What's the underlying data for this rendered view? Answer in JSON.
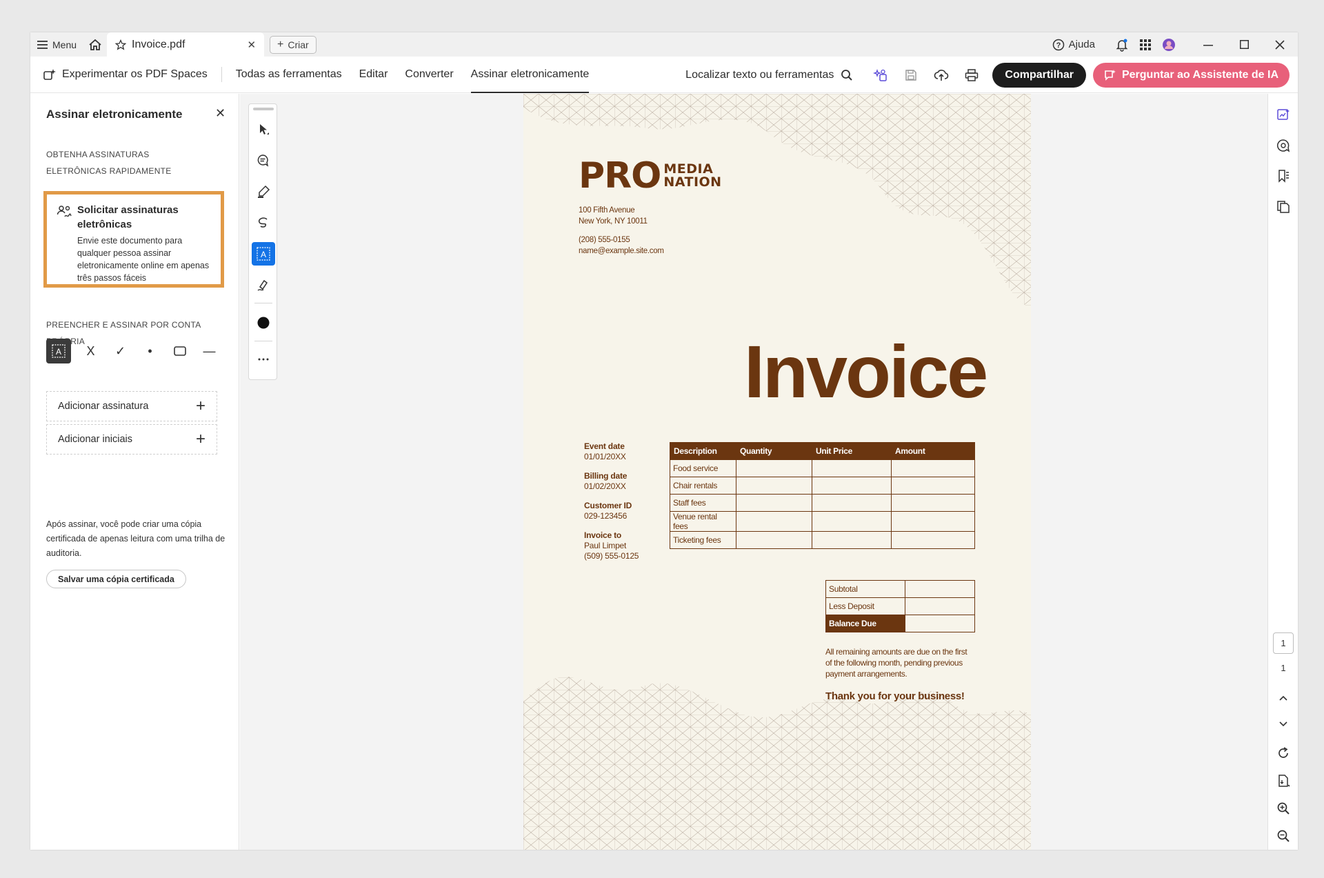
{
  "tabbar": {
    "menu_label": "Menu",
    "tab_title": "Invoice.pdf",
    "create_label": "Criar",
    "help_label": "Ajuda"
  },
  "toolbar": {
    "try_spaces": "Experimentar os PDF Spaces",
    "nav": [
      "Todas as ferramentas",
      "Editar",
      "Converter",
      "Assinar eletronicamente"
    ],
    "active_nav": "Assinar eletronicamente",
    "find_label": "Localizar texto ou ferramentas",
    "share_label": "Compartilhar",
    "ai_label": "Perguntar ao Assistente de IA"
  },
  "panel": {
    "title": "Assinar eletronicamente",
    "section1": "OBTENHA ASSINATURAS ELETRÔNICAS RAPIDAMENTE",
    "request_title": "Solicitar assinaturas eletrônicas",
    "request_desc": "Envie este documento para qualquer pessoa assinar eletronicamente online em apenas três passos fáceis",
    "section2": "PREENCHER E ASSINAR POR CONTA PRÓPRIA",
    "tool_x": "X",
    "tool_check": "✓",
    "tool_dot": "•",
    "tool_line": "—",
    "add_signature": "Adicionar assinatura",
    "add_initials": "Adicionar iniciais",
    "note": "Após assinar, você pode criar uma cópia certificada de apenas leitura com uma trilha de auditoria.",
    "cert_button": "Salvar uma cópia certificada"
  },
  "document": {
    "brand_pro": "PRO",
    "brand_media": "MEDIA",
    "brand_nation": "NATION",
    "address_line1": "100 Fifth Avenue",
    "address_line2": "New York, NY 10011",
    "phone": "(208) 555-0155",
    "email": "name@example.site.com",
    "title": "Invoice",
    "meta": [
      {
        "label": "Event date",
        "value": "01/01/20XX"
      },
      {
        "label": "Billing date",
        "value": "01/02/20XX"
      },
      {
        "label": "Customer ID",
        "value": "029-123456"
      },
      {
        "label": "Invoice to",
        "value": "Paul Limpet",
        "extra": "(509) 555-0125"
      }
    ],
    "table_headers": [
      "Description",
      "Quantity",
      "Unit Price",
      "Amount"
    ],
    "table_rows": [
      "Food service",
      "Chair rentals",
      "Staff fees",
      "Venue rental fees",
      "Ticketing fees"
    ],
    "subtotal": "Subtotal",
    "less_deposit": "Less Deposit",
    "balance_due": "Balance Due",
    "remaining_note": "All remaining amounts are due on the first of the following month, pending previous payment arrangements.",
    "thanks": "Thank you for your business!"
  },
  "rail": {
    "current_page": "1",
    "total_pages": "1"
  },
  "colors": {
    "brand_brown": "#6b3610",
    "page_bg": "#f7f4ea",
    "highlight_orange": "#e19a47",
    "selected_blue": "#1473e6",
    "ai_pink": "#e8607a"
  }
}
